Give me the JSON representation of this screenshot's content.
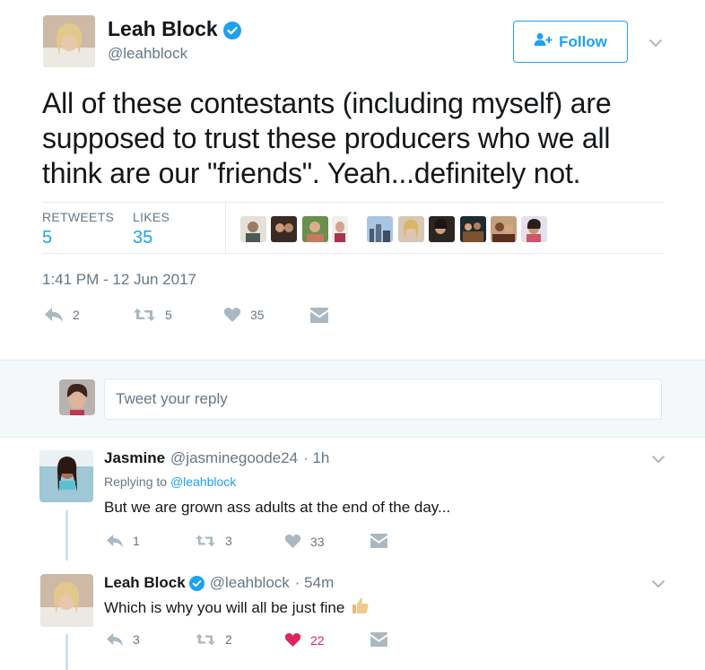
{
  "tweet": {
    "author_name": "Leah Block",
    "author_handle": "@leahblock",
    "follow_label": "Follow",
    "text": "All of these contestants (including myself) are supposed to trust these producers who we all think are our \"friends\". Yeah...definitely not.",
    "retweets_label": "RETWEETS",
    "retweets_count": "5",
    "likes_label": "LIKES",
    "likes_count": "35",
    "timestamp": "1:41 PM - 12 Jun 2017",
    "actions": {
      "reply_count": "2",
      "retweet_count": "5",
      "like_count": "35"
    }
  },
  "reply_box": {
    "placeholder": "Tweet your reply"
  },
  "replies": [
    {
      "name": "Jasmine",
      "handle": "@jasminegoode24",
      "time": "· 1h",
      "replying_prefix": "Replying to",
      "replying_to": "@leahblock",
      "text": "But we are grown ass adults at the end of the day...",
      "reply_count": "1",
      "retweet_count": "3",
      "like_count": "33"
    },
    {
      "name": "Leah Block",
      "handle": "@leahblock",
      "time": "· 54m",
      "text": "Which is why you will all be just fine",
      "reply_count": "3",
      "retweet_count": "2",
      "like_count": "22"
    }
  ],
  "colors": {
    "accent": "#1da1f2",
    "muted": "#657786",
    "liked": "#e0245e",
    "icon": "#aab8c2"
  }
}
